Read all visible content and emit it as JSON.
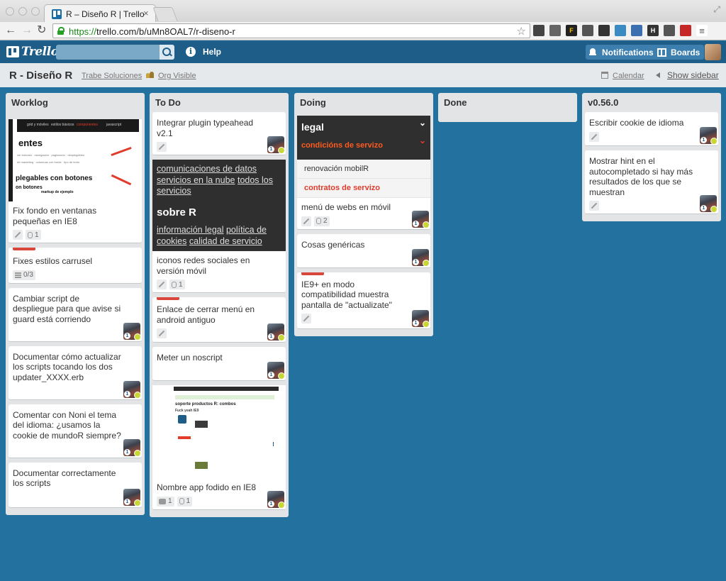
{
  "browser": {
    "tab_title": "R – Diseño R | Trello",
    "url_scheme": "https://",
    "url_rest": "trello.com/b/uMn8OAL7/r-diseno-r"
  },
  "header": {
    "logo": "Trello",
    "help": "Help",
    "notifications": "Notifications",
    "boards": "Boards"
  },
  "board": {
    "title": "R - Diseño R",
    "org": "Trabe Soluciones",
    "visibility": "Org Visible",
    "calendar": "Calendar",
    "show_sidebar": "Show sidebar"
  },
  "lists": [
    {
      "title": "Worklog",
      "cards": [
        {
          "text": "Fix fondo en ventanas pequeñas en IE8",
          "attach": "1"
        },
        {
          "text": "Fixes estilos carrusel",
          "checklist": "0/3"
        },
        {
          "text": "Cambiar script de despliegue para que avise si guard está corriendo"
        },
        {
          "text": "Documentar cómo actualizar los scripts tocando los dos updater_XXXX.erb"
        },
        {
          "text": "Comentar con Noni el tema del idioma: ¿usamos la cookie de mundoR siempre?"
        },
        {
          "text": "Documentar correctamente los scripts"
        }
      ]
    },
    {
      "title": "To Do",
      "cards": [
        {
          "text": "Integrar plugin typeahead v2.1"
        },
        {
          "text": "iconos redes sociales en versión móvil",
          "attach": "1"
        },
        {
          "text": "Enlace de cerrar menú en android antiguo"
        },
        {
          "text": "Meter un noscript"
        },
        {
          "text": "Nombre app fodido en IE8",
          "comments": "1",
          "attach": "1"
        }
      ]
    },
    {
      "title": "Doing",
      "cards": [
        {
          "text": "menú de webs en móvil",
          "attach": "2"
        },
        {
          "text": "Cosas genéricas"
        },
        {
          "text": "IE9+ en modo compatibilidad muestra pantalla de \"actualizate\""
        }
      ]
    },
    {
      "title": "Done",
      "cards": []
    },
    {
      "title": "v0.56.0",
      "cards": [
        {
          "text": "Escribir cookie de idioma"
        },
        {
          "text": "Mostrar hint en el autocompletado si hay más resultados de los que se muestran"
        }
      ]
    }
  ],
  "covers": {
    "ss1": {
      "tabs": [
        "grid y móviles",
        "estilos básicos",
        "componentes",
        "javascript"
      ],
      "heading1": "entes",
      "heading2": "plegables con botones",
      "heading3": "on botones",
      "example": "markup de ejemplo"
    },
    "ss2": {
      "line1a": "comunicaciones de datos",
      "line1b": "servicios en la nube",
      "line1c": "todos los",
      "line1d": "servicios",
      "head": "sobre R",
      "line2a": "información legal",
      "line2b": "política de",
      "line2c": "cookies",
      "line2d": "calidad de servicio"
    },
    "ss3": {
      "head": "legal",
      "row1": "condicións de servizo",
      "row2": "renovación mobilR",
      "row3": "contratos de servizo"
    },
    "ss4": {
      "title": "soporte productos R: combos",
      "subtitle": "Fuck yeah IE9"
    }
  }
}
